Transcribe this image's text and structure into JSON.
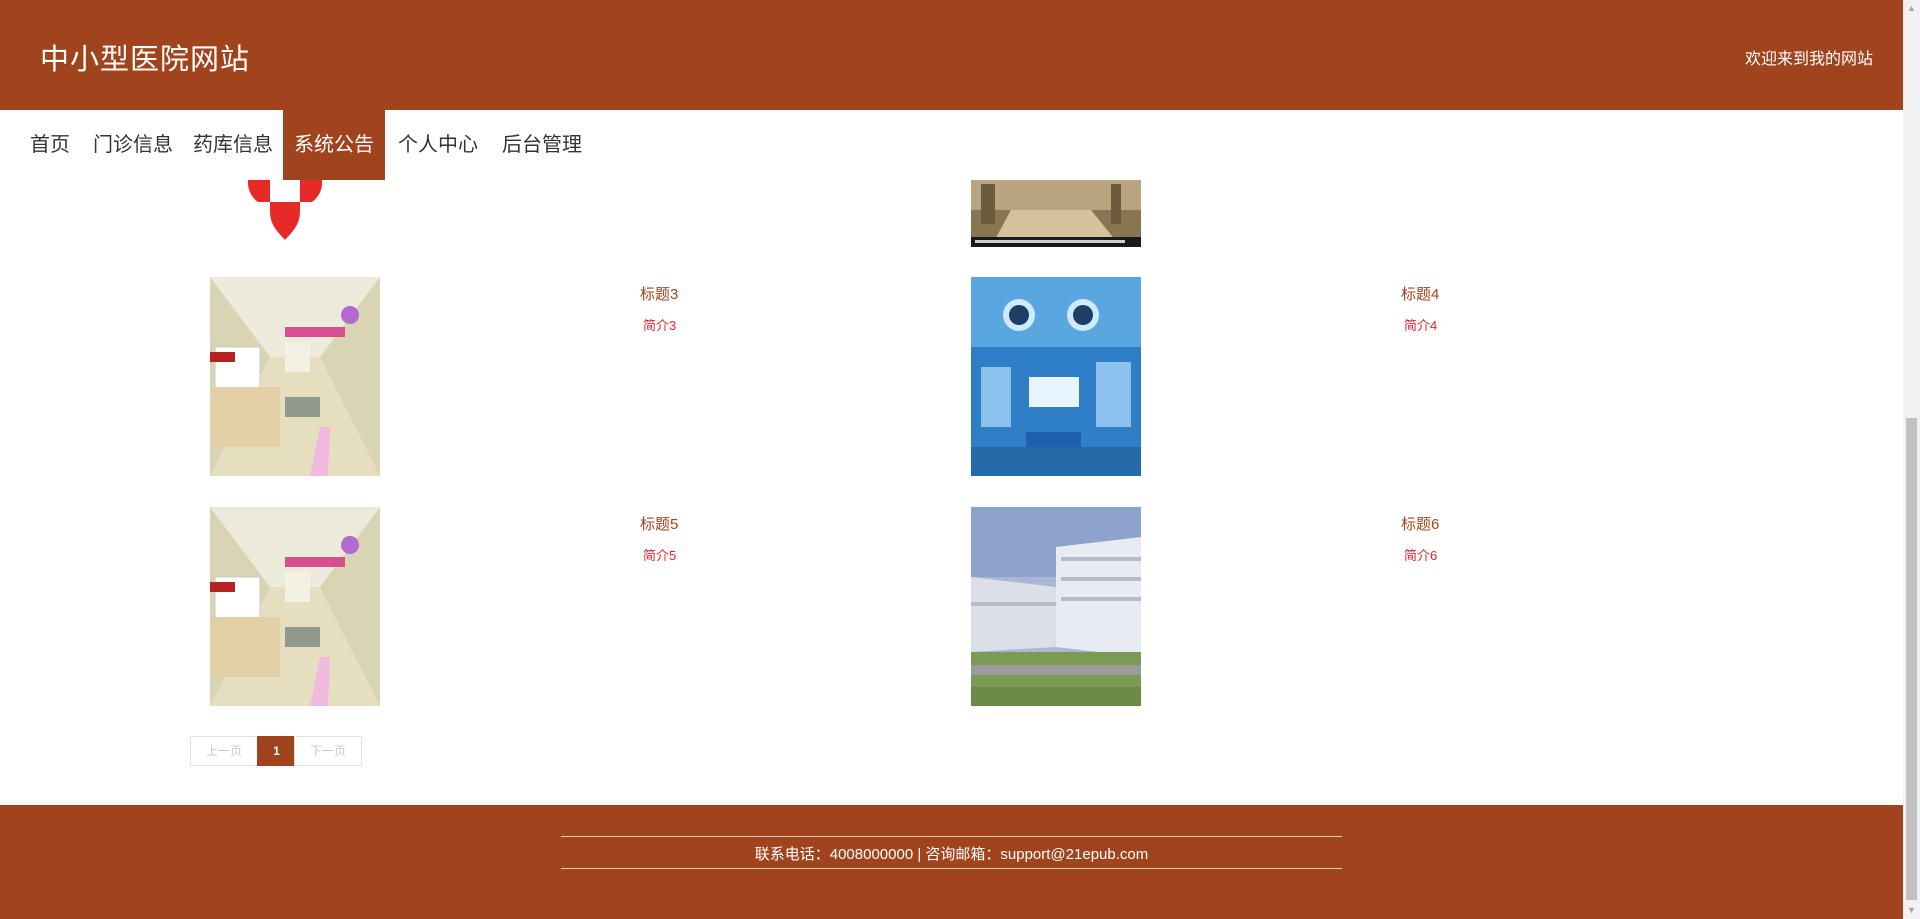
{
  "header": {
    "site_title": "中小型医院网站",
    "welcome": "欢迎来到我的网站"
  },
  "nav": {
    "items": [
      {
        "label": "首页",
        "active": false
      },
      {
        "label": "门诊信息",
        "active": false
      },
      {
        "label": "药库信息",
        "active": false
      },
      {
        "label": "系统公告",
        "active": true
      },
      {
        "label": "个人中心",
        "active": false
      },
      {
        "label": "后台管理",
        "active": false
      }
    ]
  },
  "cards": [
    {
      "title": "标题3",
      "desc": "简介3",
      "image": "hospital-corridor"
    },
    {
      "title": "标题4",
      "desc": "简介4",
      "image": "operating-room"
    },
    {
      "title": "标题5",
      "desc": "简介5",
      "image": "hospital-corridor"
    },
    {
      "title": "标题6",
      "desc": "简介6",
      "image": "hospital-building"
    }
  ],
  "pagination": {
    "prev": "上一页",
    "current": "1",
    "next": "下一页"
  },
  "footer": {
    "contact": "联系电话：4008000000 | 咨询邮箱：support@21epub.com"
  },
  "colors": {
    "brand": "#a0441d",
    "title_text": "#a0441d",
    "desc_text": "#e8242c"
  }
}
